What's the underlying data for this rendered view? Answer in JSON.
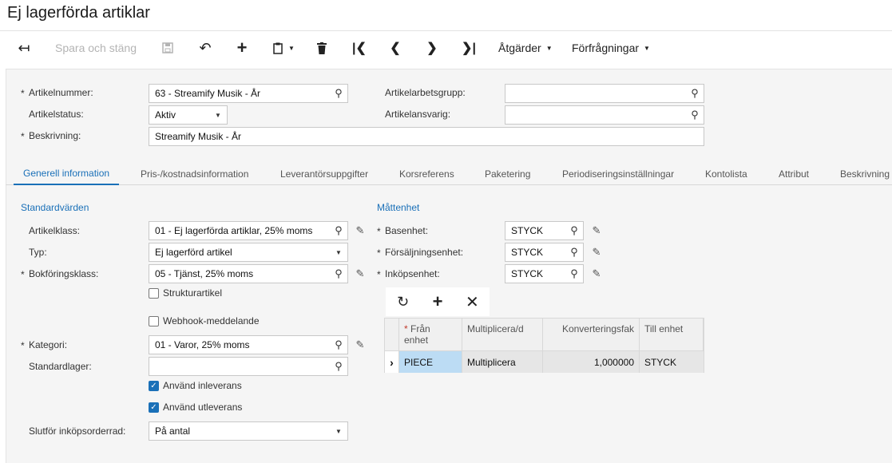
{
  "page": {
    "title": "Ej lagerförda artiklar"
  },
  "toolbar": {
    "save_close": "Spara och stäng",
    "actions": "Åtgärder",
    "inquiries": "Förfrågningar"
  },
  "header": {
    "item_number_label": "Artikelnummer:",
    "item_number_value": "63 - Streamify Musik - År",
    "item_status_label": "Artikelstatus:",
    "item_status_value": "Aktiv",
    "description_label": "Beskrivning:",
    "description_value": "Streamify Musik - År",
    "work_group_label": "Artikelarbetsgrupp:",
    "work_group_value": "",
    "owner_label": "Artikelansvarig:",
    "owner_value": ""
  },
  "tabs": [
    {
      "label": "Generell information"
    },
    {
      "label": "Pris-/kostnadsinformation"
    },
    {
      "label": "Leverantörsuppgifter"
    },
    {
      "label": "Korsreferens"
    },
    {
      "label": "Paketering"
    },
    {
      "label": "Periodiseringsinställningar"
    },
    {
      "label": "Kontolista"
    },
    {
      "label": "Attribut"
    },
    {
      "label": "Beskrivning"
    }
  ],
  "defaults": {
    "title": "Standardvärden",
    "item_class_label": "Artikelklass:",
    "item_class_value": "01 - Ej lagerförda artiklar, 25% moms",
    "type_label": "Typ:",
    "type_value": "Ej lagerförd artikel",
    "posting_class_label": "Bokföringsklass:",
    "posting_class_value": "05 - Tjänst, 25% moms",
    "structure_item_label": "Strukturartikel",
    "webhook_label": "Webhook-meddelande",
    "category_label": "Kategori:",
    "category_value": "01 - Varor, 25% moms",
    "default_warehouse_label": "Standardlager:",
    "default_warehouse_value": "",
    "use_receipt_label": "Använd inleverans",
    "use_shipment_label": "Använd utleverans",
    "complete_po_line_label": "Slutför inköpsorderrad:",
    "complete_po_line_value": "På antal"
  },
  "uom": {
    "title": "Måttenhet",
    "base_label": "Basenhet:",
    "base_value": "STYCK",
    "sales_label": "Försäljningsenhet:",
    "sales_value": "STYCK",
    "purchase_label": "Inköpsenhet:",
    "purchase_value": "STYCK"
  },
  "conversion_grid": {
    "columns": [
      "Från enhet",
      "Multiplicera/d",
      "Konverteringsfak",
      "Till enhet"
    ],
    "rows": [
      {
        "from": "PIECE",
        "mult": "Multiplicera",
        "factor": "1,000000",
        "to": "STYCK"
      }
    ]
  },
  "checkboxes": {
    "structure_item": false,
    "webhook": false,
    "use_receipt": true,
    "use_shipment": true
  },
  "colors": {
    "accent": "#1a70b8",
    "selected_cell": "#bcdcf4"
  }
}
